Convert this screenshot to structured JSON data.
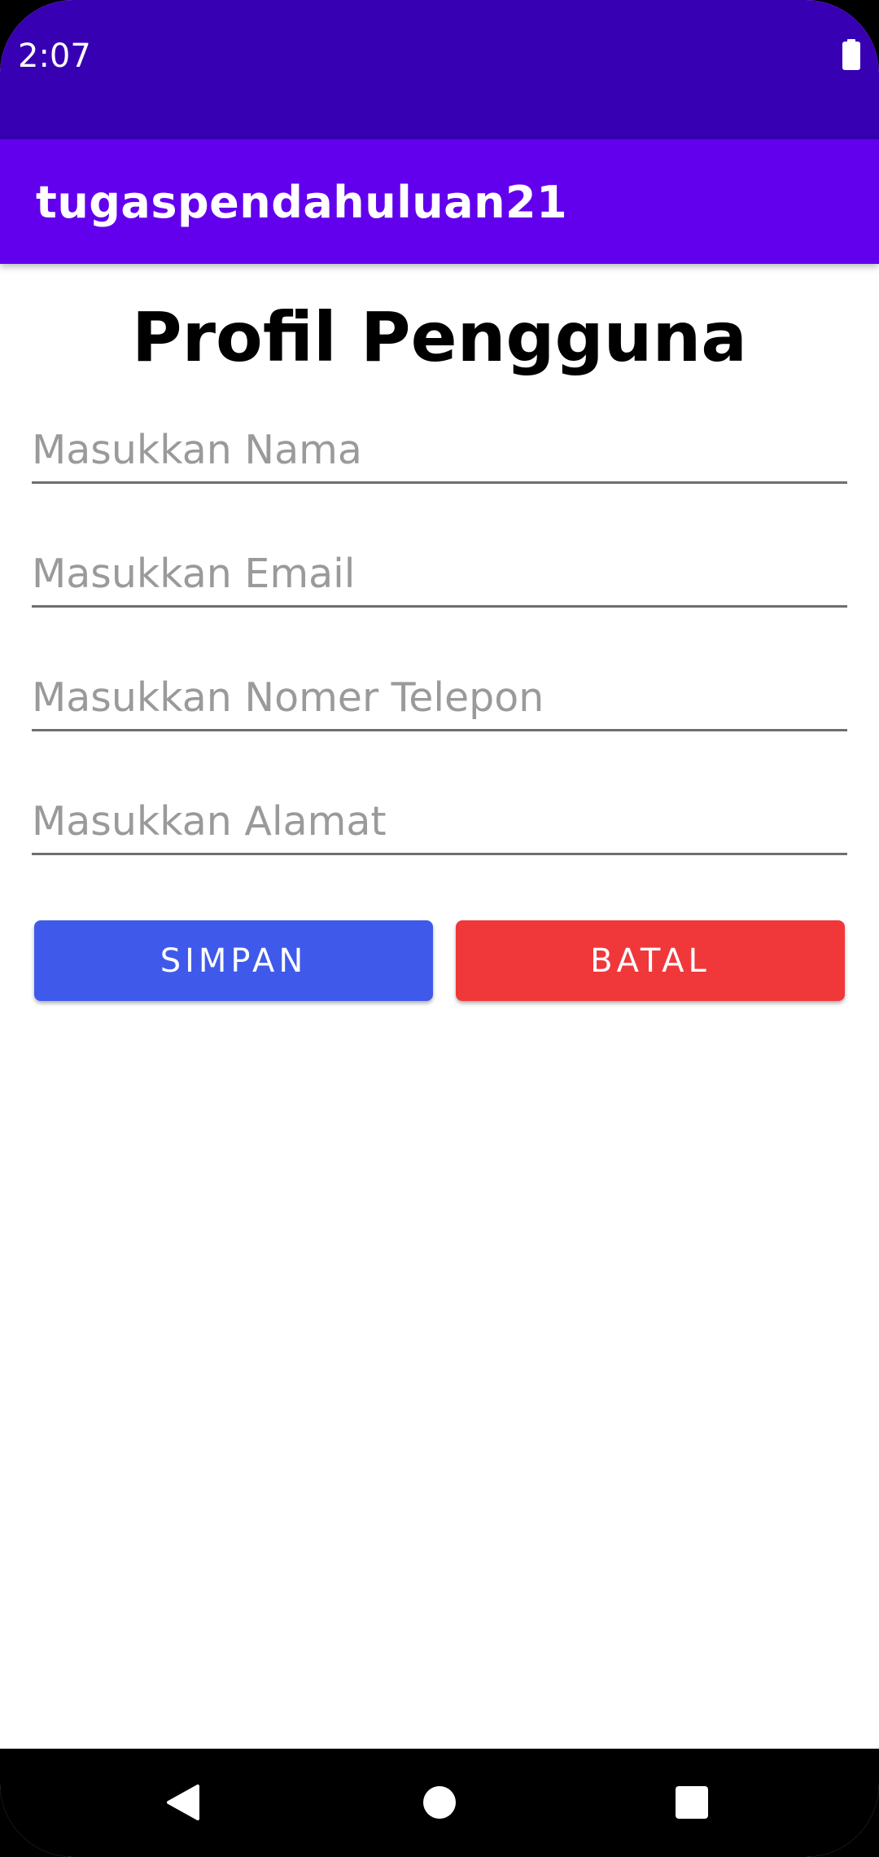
{
  "status_bar": {
    "time": "2:07",
    "battery_icon": "battery-icon"
  },
  "app_bar": {
    "title": "tugaspendahuluan21"
  },
  "page": {
    "title": "Profil Pengguna"
  },
  "form": {
    "nama": {
      "placeholder": "Masukkan Nama",
      "value": ""
    },
    "email": {
      "placeholder": "Masukkan Email",
      "value": ""
    },
    "telepon": {
      "placeholder": "Masukkan Nomer Telepon",
      "value": ""
    },
    "alamat": {
      "placeholder": "Masukkan Alamat",
      "value": ""
    }
  },
  "buttons": {
    "save_label": "SIMPAN",
    "cancel_label": "BATAL"
  },
  "nav_bar": {
    "back_icon": "back-icon",
    "home_icon": "home-icon",
    "recent_icon": "recent-apps-icon"
  },
  "colors": {
    "status_bar": "#3700B3",
    "app_bar": "#6200EE",
    "save_button": "#3F5AEA",
    "cancel_button": "#F0383B"
  }
}
